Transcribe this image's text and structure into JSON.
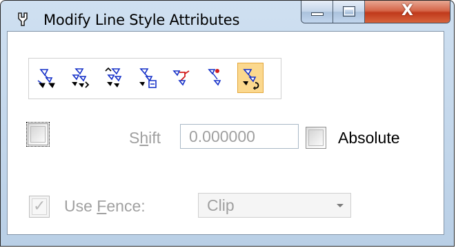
{
  "window": {
    "title": "Modify Line Style Attributes",
    "close_glyph": "X"
  },
  "toolbar": {
    "tools": [
      {
        "icon": "linestyle-tool-1-icon"
      },
      {
        "icon": "linestyle-tool-2-icon"
      },
      {
        "icon": "linestyle-tool-3-icon"
      },
      {
        "icon": "linestyle-tool-4-icon"
      },
      {
        "icon": "linestyle-tool-5-icon"
      },
      {
        "icon": "linestyle-tool-6-icon"
      },
      {
        "icon": "linestyle-tool-7-icon",
        "active": true
      }
    ],
    "active_color": "#fbd88e"
  },
  "shift": {
    "label_pre": "S",
    "label_u": "h",
    "label_post": "ift",
    "value": "0.000000"
  },
  "absolute": {
    "label": "Absolute"
  },
  "fence": {
    "label_pre": "Use ",
    "label_u": "F",
    "label_post": "ence:",
    "checked_glyph": "✓",
    "select_value": "Clip"
  }
}
